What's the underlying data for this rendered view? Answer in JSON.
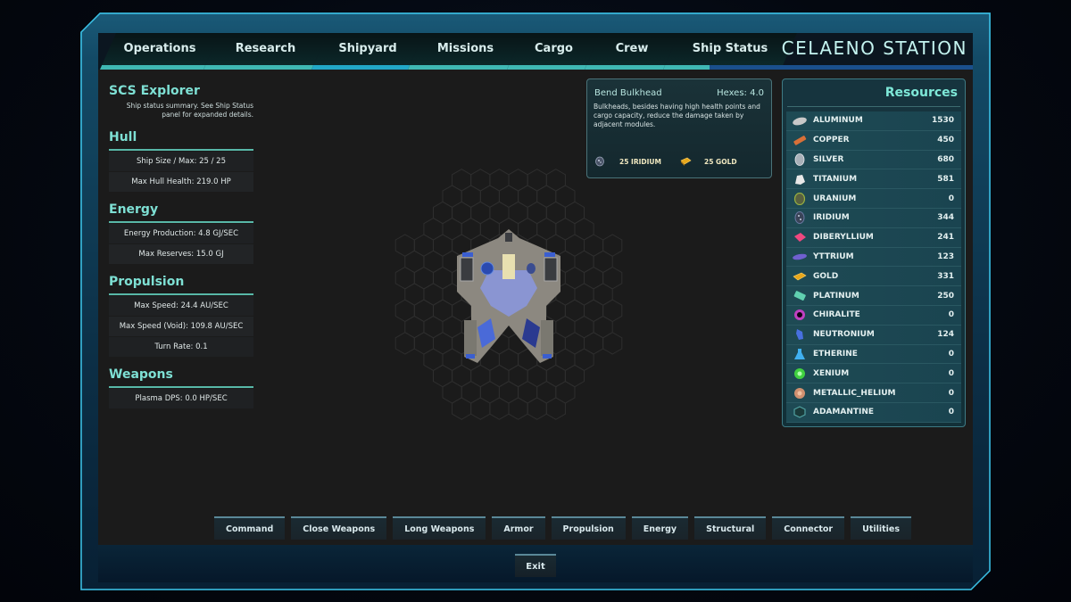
{
  "station": {
    "title": "CELAENO STATION"
  },
  "tabs": [
    {
      "label": "Operations",
      "active": false
    },
    {
      "label": "Research",
      "active": false
    },
    {
      "label": "Shipyard",
      "active": true
    },
    {
      "label": "Missions",
      "active": false
    },
    {
      "label": "Cargo",
      "active": false
    },
    {
      "label": "Crew",
      "active": false
    },
    {
      "label": "Ship Status",
      "active": false
    }
  ],
  "ship": {
    "name": "SCS Explorer",
    "description": "Ship status summary. See Ship Status panel for expanded details.",
    "sections": [
      {
        "title": "Hull",
        "stats": [
          "Ship Size / Max: 25 / 25",
          "Max Hull Health: 219.0 HP"
        ]
      },
      {
        "title": "Energy",
        "stats": [
          "Energy Production: 4.8 GJ/SEC",
          "Max Reserves: 15.0 GJ"
        ]
      },
      {
        "title": "Propulsion",
        "stats": [
          "Max Speed: 24.4 AU/SEC",
          "Max Speed (Void): 109.8 AU/SEC",
          "Turn Rate: 0.1"
        ]
      },
      {
        "title": "Weapons",
        "stats": [
          "Plasma DPS: 0.0 HP/SEC"
        ]
      }
    ]
  },
  "tooltip": {
    "title": "Bend Bulkhead",
    "hexes": "Hexes: 4.0",
    "description": "Bulkheads, besides having high health points and cargo capacity, reduce the damage taken by adjacent modules.",
    "costs": [
      {
        "icon": "iridium-icon",
        "label": "25  IRIDIUM",
        "color": "#8a96a8"
      },
      {
        "icon": "gold-icon",
        "label": "25  GOLD",
        "color": "#e8a81c"
      }
    ]
  },
  "resources": {
    "title": "Resources",
    "items": [
      {
        "name": "ALUMINUM",
        "value": "1530",
        "icon": "aluminum-icon",
        "color": "#c8c8c8"
      },
      {
        "name": "COPPER",
        "value": "450",
        "icon": "copper-icon",
        "color": "#d87038"
      },
      {
        "name": "SILVER",
        "value": "680",
        "icon": "silver-icon",
        "color": "#a8b0b8"
      },
      {
        "name": "TITANIUM",
        "value": "581",
        "icon": "titanium-icon",
        "color": "#e8e8e8"
      },
      {
        "name": "URANIUM",
        "value": "0",
        "icon": "uranium-icon",
        "color": "#98b040"
      },
      {
        "name": "IRIDIUM",
        "value": "344",
        "icon": "iridium-icon",
        "color": "#6878a0"
      },
      {
        "name": "DIBERYLLIUM",
        "value": "241",
        "icon": "diberyllium-icon",
        "color": "#f04880"
      },
      {
        "name": "YTTRIUM",
        "value": "123",
        "icon": "yttrium-icon",
        "color": "#7060d0"
      },
      {
        "name": "GOLD",
        "value": "331",
        "icon": "gold-icon",
        "color": "#e8a81c"
      },
      {
        "name": "PLATINUM",
        "value": "250",
        "icon": "platinum-icon",
        "color": "#60d0b0"
      },
      {
        "name": "CHIRALITE",
        "value": "0",
        "icon": "chiralite-icon",
        "color": "#c040c0"
      },
      {
        "name": "NEUTRONIUM",
        "value": "124",
        "icon": "neutronium-icon",
        "color": "#4870e0"
      },
      {
        "name": "ETHERINE",
        "value": "0",
        "icon": "etherine-icon",
        "color": "#40b0f0"
      },
      {
        "name": "XENIUM",
        "value": "0",
        "icon": "xenium-icon",
        "color": "#40d040"
      },
      {
        "name": "METALLIC_HELIUM",
        "value": "0",
        "icon": "metallic-helium-icon",
        "color": "#d09070"
      },
      {
        "name": "ADAMANTINE",
        "value": "0",
        "icon": "adamantine-icon",
        "color": "#50a0a0"
      }
    ]
  },
  "categories": [
    "Command",
    "Close Weapons",
    "Long Weapons",
    "Armor",
    "Propulsion",
    "Energy",
    "Structural",
    "Connector",
    "Utilities"
  ],
  "exit_label": "Exit"
}
